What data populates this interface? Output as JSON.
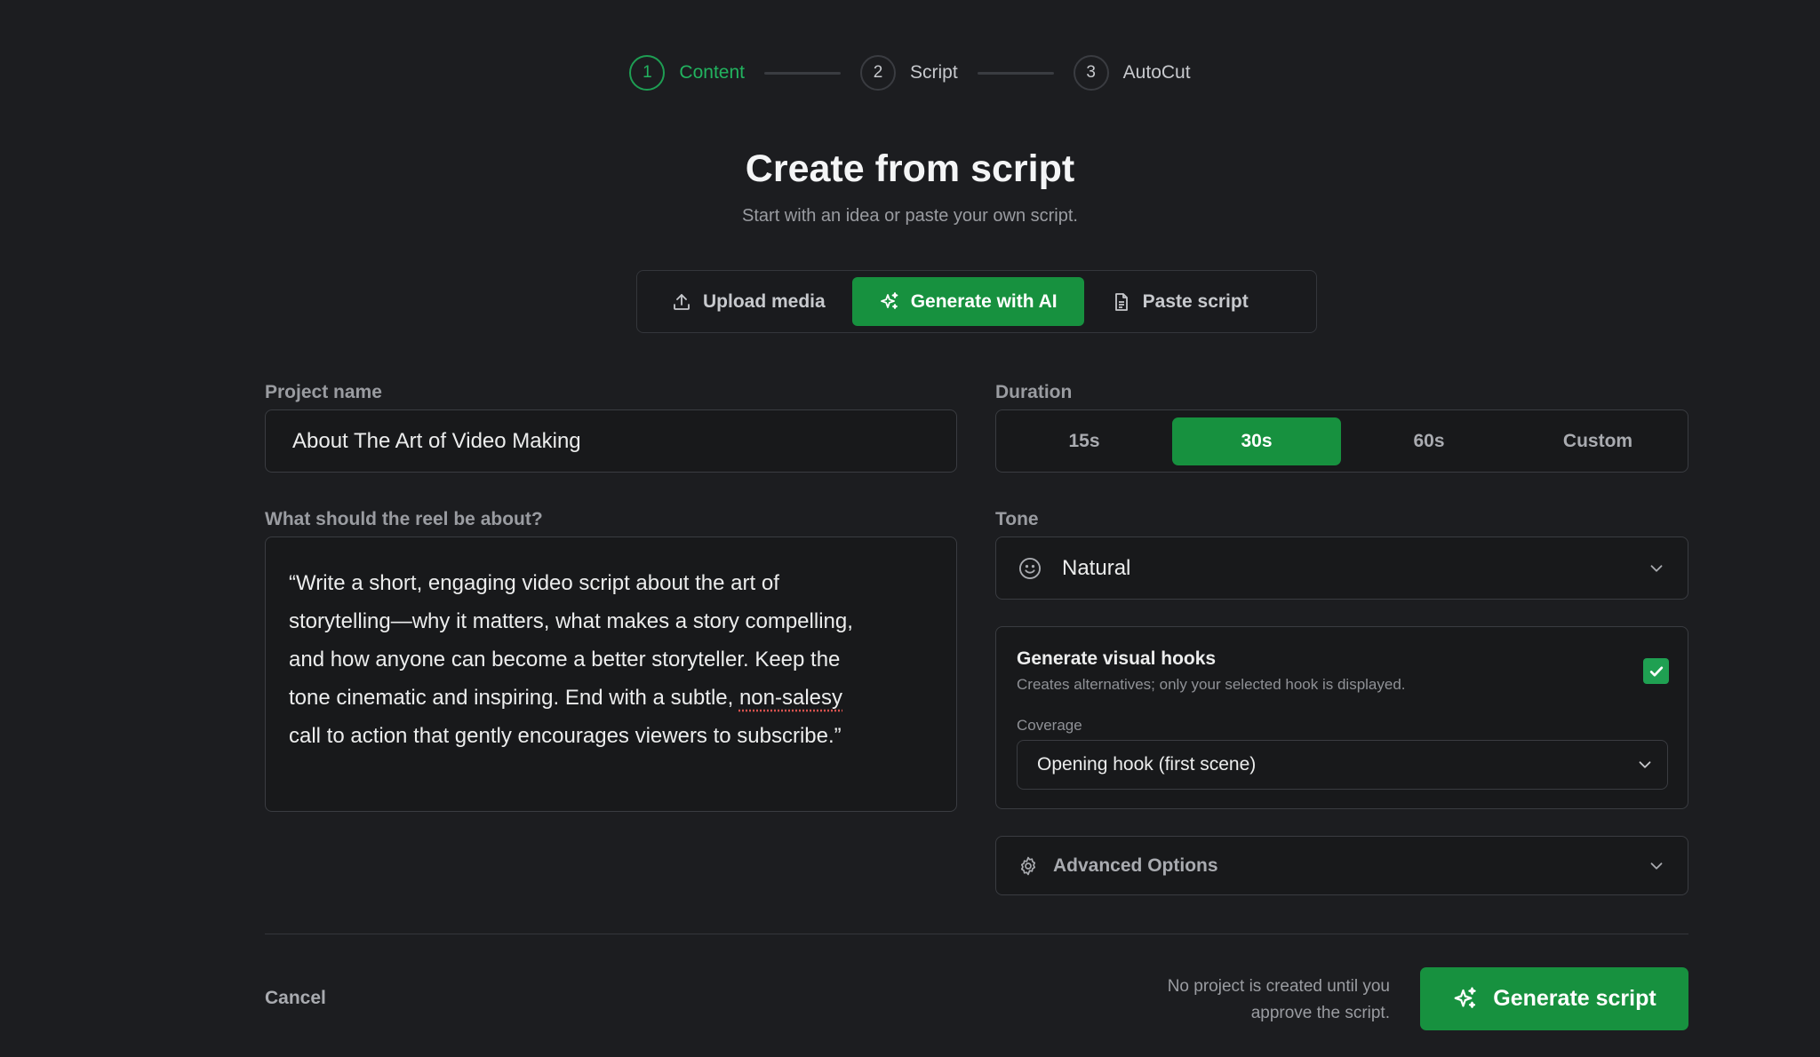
{
  "stepper": {
    "steps": [
      {
        "number": "1",
        "label": "Content",
        "state": "active"
      },
      {
        "number": "2",
        "label": "Script",
        "state": "pending"
      },
      {
        "number": "3",
        "label": "AutoCut",
        "state": "pending"
      }
    ]
  },
  "header": {
    "title": "Create from script",
    "subtitle": "Start with an idea or paste your own script."
  },
  "modes": {
    "items": [
      {
        "label": "Upload media",
        "icon": "upload-icon"
      },
      {
        "label": "Generate with AI",
        "icon": "sparkles-icon",
        "selected": true
      },
      {
        "label": "Paste script",
        "icon": "document-icon"
      }
    ]
  },
  "project": {
    "label": "Project name",
    "value": "About The Art of Video Making"
  },
  "prompt": {
    "label": "What should the reel be about?",
    "value": "“Write a short, engaging video script about the art of storytelling—why it matters, what makes a story compelling, and how anyone can become a better storyteller. Keep the tone cinematic and inspiring. End with a subtle, non-salesy call to action that gently encourages viewers to subscribe.”",
    "lines": [
      "“Write a short, engaging video script about the art of",
      "storytelling—why it matters, what makes a story compelling,",
      "and how anyone can become a better storyteller. Keep the",
      "tone cinematic and inspiring. End with a subtle, ",
      "call to action that gently encourages viewers to subscribe.”"
    ],
    "misspelled_word": "non-salesy"
  },
  "duration": {
    "label": "Duration",
    "options": [
      "15s",
      "30s",
      "60s",
      "Custom"
    ],
    "selected": "30s"
  },
  "tone": {
    "label": "Tone",
    "value": "Natural",
    "icon": "smiley-icon"
  },
  "hooks": {
    "title": "Generate visual hooks",
    "description": "Creates alternatives; only your selected hook is displayed.",
    "checked": true,
    "coverage_label": "Coverage",
    "coverage_value": "Opening hook (first scene)"
  },
  "advanced": {
    "label": "Advanced Options",
    "icon": "gear-icon"
  },
  "footer": {
    "cancel_label": "Cancel",
    "note_line1": "No project is created until you",
    "note_line2": "approve the script.",
    "generate_label": "Generate script"
  },
  "colors": {
    "accent": "#17913f",
    "background": "#1c1d20"
  }
}
